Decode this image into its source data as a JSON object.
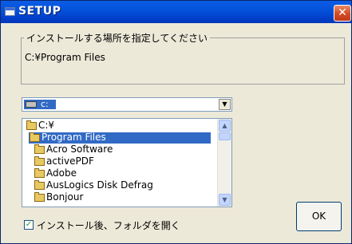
{
  "window": {
    "title": "SETUP",
    "close_glyph": "✕"
  },
  "install_location": {
    "group_label": "インストールする場所を指定してください",
    "path": "C:¥Program Files"
  },
  "drive": {
    "selected": "c:"
  },
  "directory_list": {
    "items": [
      {
        "label": "C:¥",
        "selected": false
      },
      {
        "label": "Program Files",
        "selected": true
      },
      {
        "label": "Acro Software",
        "selected": false
      },
      {
        "label": "activePDF",
        "selected": false
      },
      {
        "label": "Adobe",
        "selected": false
      },
      {
        "label": "AusLogics Disk Defrag",
        "selected": false
      },
      {
        "label": "Bonjour",
        "selected": false
      }
    ]
  },
  "open_folder_option": {
    "label": "インストール後、フォルダを開く",
    "checked": true,
    "check_glyph": "✓"
  },
  "ok_button": {
    "label": "OK"
  },
  "icons": [
    "app-icon",
    "close-icon",
    "drive-icon",
    "folder-icon",
    "chevron-down-icon",
    "scroll-up-icon",
    "scroll-down-icon"
  ]
}
